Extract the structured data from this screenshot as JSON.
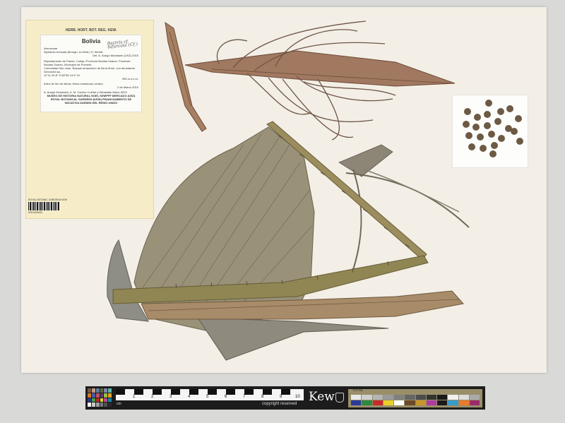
{
  "sheet": {
    "envelope_color": "#f6edc8",
    "sheet_color": "#f3efe6"
  },
  "label": {
    "herbarium": "HERB. HORT. BOT. REG. KEW.",
    "country": "Bolivia",
    "family": "Arecaceae",
    "taxon": "Aiphanes truncata (Brongn. ex Mart.) H. Wendl.",
    "det": "Det. A. Araujo Murakami (USZ) 2015",
    "handwritten": "Bactris cf. bifurcata (Cf.)",
    "locality": "Departamento de Pando, Cobija, Provincia Nicolas Suarez. Provincia Nicolas Suarez, Municipio de Porvenir.",
    "habitat": "Comunidad San Jose. Bosque amazonico de tierra firme, con abundante Geonoma sp.",
    "coords": "11°11 09.8\" S 68°56 14.9\" W",
    "elevation": "255 m.s.n.m.",
    "notes": "Arbol de 5m de altura; frutos inmaduros verdes.",
    "date": "2 de Marzo 2015",
    "collectors": "A. Araujo Murakami, A. M. Carrion Cuellar y Sebastian Nalvo 5203",
    "institution": "MUSEO DE HISTORIA NATURAL NOEL KEMPFF MERCADO (USZ) ROYAL BOTANICAL GARDENS (KEW) FINANCIAMIENTO DE INICIATIVA DARWIN DEL REINO UNIDO"
  },
  "barcode": {
    "caption": "ROYAL BOTANIC GARDENS KEW",
    "number": "K001409053"
  },
  "ruler": {
    "numbers": [
      "1",
      "2",
      "3",
      "4",
      "5",
      "6",
      "7",
      "8",
      "9",
      "10"
    ],
    "unit": "cm",
    "copyright": "copyright reserved",
    "brand": "Kew",
    "color_label": "TIFFEN"
  },
  "seeds": {
    "color": "#6e5a44",
    "count": 22
  }
}
